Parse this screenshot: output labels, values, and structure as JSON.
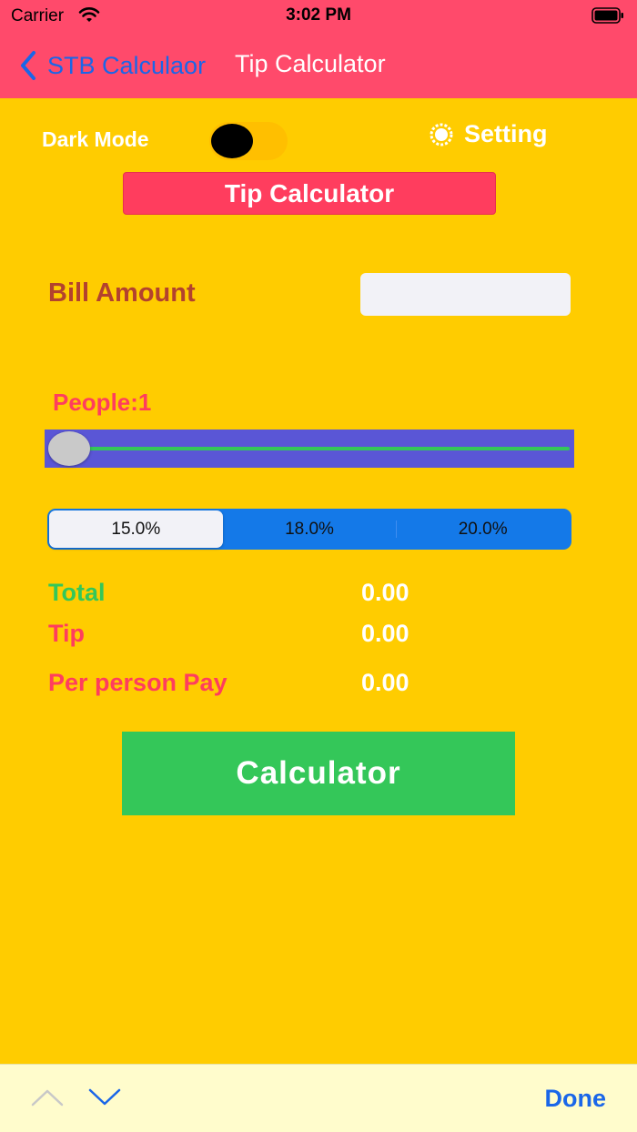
{
  "status_bar": {
    "carrier": "Carrier",
    "time": "3:02 PM"
  },
  "nav": {
    "back_label": "STB Calculaor",
    "title": "Tip Calculator"
  },
  "controls": {
    "dark_mode_label": "Dark Mode",
    "dark_mode_on": false,
    "setting_label": "Setting"
  },
  "app_title": "Tip Calculator",
  "bill": {
    "label": "Bill Amount",
    "value": "",
    "placeholder": ""
  },
  "people": {
    "label": "People:1",
    "slider_value": 1
  },
  "tip_options": [
    {
      "label": "15.0%",
      "selected": true
    },
    {
      "label": "18.0%",
      "selected": false
    },
    {
      "label": "20.0%",
      "selected": false
    }
  ],
  "results": {
    "total_label": "Total",
    "total_value": "0.00",
    "tip_label": "Tip",
    "tip_value": "0.00",
    "per_person_label": "Per person Pay",
    "per_person_value": "0.00"
  },
  "calculate_button": "Calculator",
  "keyboard_toolbar": {
    "done_label": "Done"
  },
  "colors": {
    "background": "#ffcc00",
    "header": "#ff4a6b",
    "title_bar": "#ff3d5e",
    "bill_label": "#b3422e",
    "people_label": "#ff3d5e",
    "total_label": "#34c759",
    "tip_label": "#ff3d5e",
    "button": "#34c759",
    "segment": "#1479e8",
    "slider_box": "#5a56d6",
    "link": "#1a66e8"
  }
}
